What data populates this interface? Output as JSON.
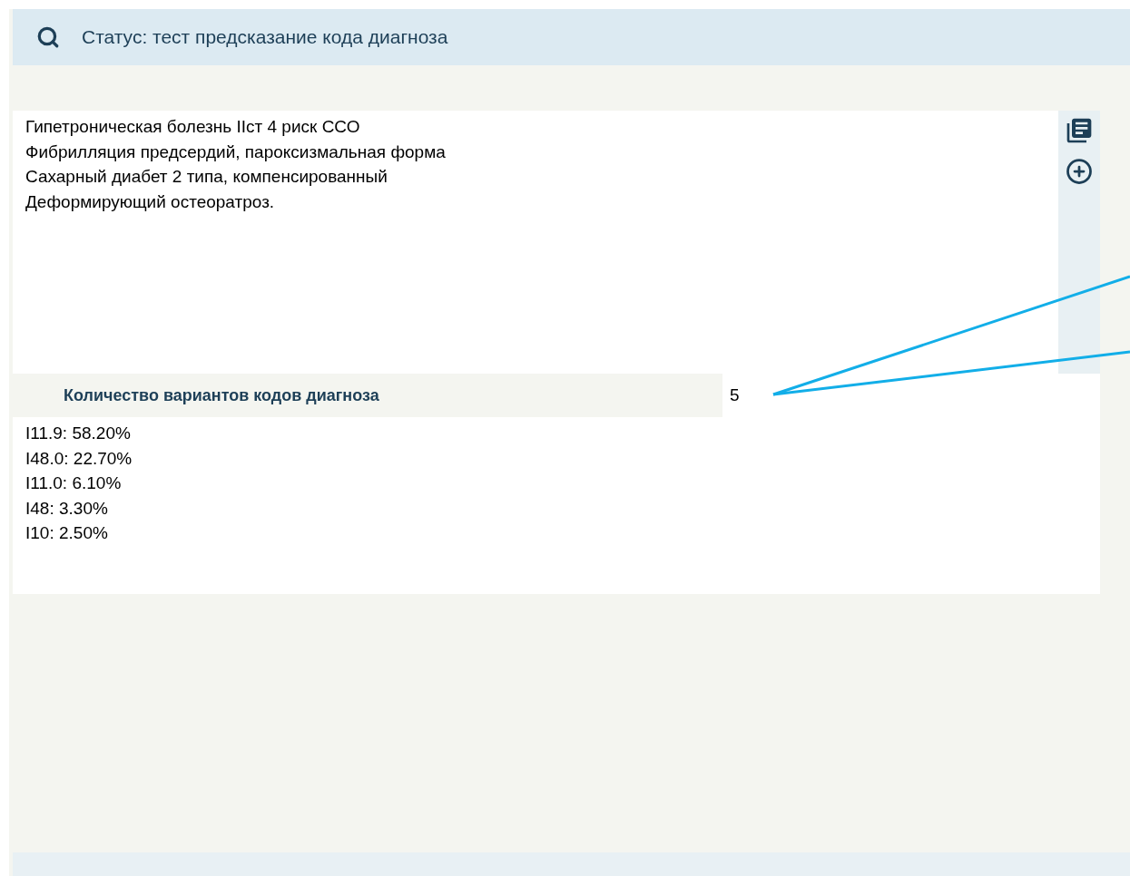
{
  "header": {
    "title": "Статус: тест предсказание кода диагноза"
  },
  "diagnosis_field": {
    "value": "Гипетроническая болезнь IIст 4 риск ССО\nФибрилляция предсердий, пароксизмальная форма\nСахарный диабет 2 типа, компенсированный\nДеформирующий остеоратроз."
  },
  "variant_count": {
    "label": "Количество вариантов кодов диагноза",
    "value": "5"
  },
  "results": [
    "I11.9: 58.20%",
    "I48.0: 22.70%",
    "I11.0: 6.10%",
    "I48: 3.30%",
    "I10: 2.50%"
  ]
}
